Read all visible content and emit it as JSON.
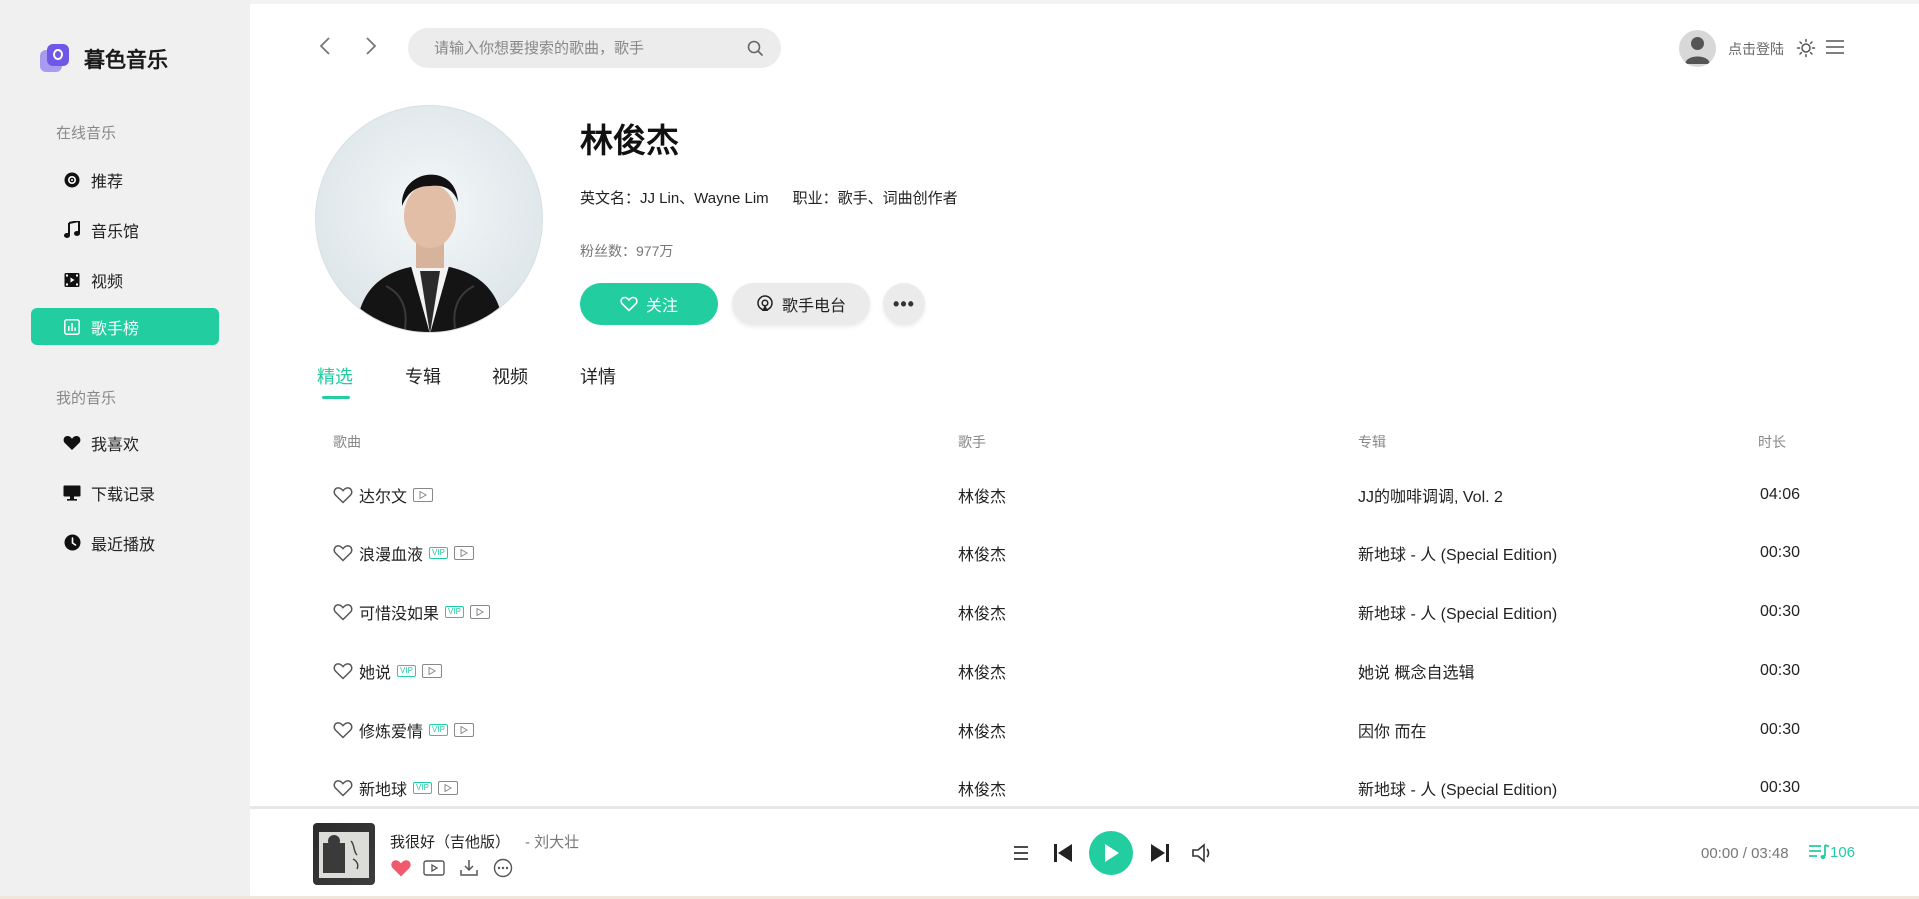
{
  "app": {
    "name": "暮色音乐"
  },
  "sidebar": {
    "group_online": "在线音乐",
    "online_items": [
      {
        "label": "推荐",
        "icon": "disc-icon"
      },
      {
        "label": "音乐馆",
        "icon": "music-note-icon"
      },
      {
        "label": "视频",
        "icon": "video-icon"
      },
      {
        "label": "歌手榜",
        "icon": "chart-icon",
        "active": true
      }
    ],
    "group_mine": "我的音乐",
    "mine_items": [
      {
        "label": "我喜欢",
        "icon": "heart-icon"
      },
      {
        "label": "下载记录",
        "icon": "monitor-icon"
      },
      {
        "label": "最近播放",
        "icon": "clock-icon"
      }
    ]
  },
  "header": {
    "search_placeholder": "请输入你想要搜索的歌曲，歌手",
    "login_text": "点击登陆"
  },
  "artist": {
    "name": "林俊杰",
    "english_name": "英文名：JJ Lin、Wayne Lim",
    "occupation": "职业：歌手、词曲创作者",
    "fans": "粉丝数：977万",
    "follow_label": "关注",
    "radio_label": "歌手电台",
    "more_label": "•••"
  },
  "tabs": [
    {
      "label": "精选",
      "active": true
    },
    {
      "label": "专辑"
    },
    {
      "label": "视频"
    },
    {
      "label": "详情"
    }
  ],
  "table": {
    "headers": {
      "song": "歌曲",
      "singer": "歌手",
      "album": "专辑",
      "duration": "时长"
    },
    "rows": [
      {
        "title": "达尔文",
        "vip": false,
        "singer": "林俊杰",
        "album": "JJ的咖啡调调, Vol. 2",
        "duration": "04:06"
      },
      {
        "title": "浪漫血液",
        "vip": true,
        "singer": "林俊杰",
        "album": "新地球 - 人 (Special Edition)",
        "duration": "00:30"
      },
      {
        "title": "可惜没如果",
        "vip": true,
        "singer": "林俊杰",
        "album": "新地球 - 人 (Special Edition)",
        "duration": "00:30"
      },
      {
        "title": "她说",
        "vip": true,
        "singer": "林俊杰",
        "album": "她说 概念自选辑",
        "duration": "00:30"
      },
      {
        "title": "修炼爱情",
        "vip": true,
        "singer": "林俊杰",
        "album": "因你 而在",
        "duration": "00:30"
      },
      {
        "title": "新地球",
        "vip": true,
        "singer": "林俊杰",
        "album": "新地球 - 人 (Special Edition)",
        "duration": "00:30"
      }
    ],
    "vip_tag": "VIP"
  },
  "player": {
    "song_title": "我很好（吉他版）",
    "song_artist": "- 刘大壮",
    "current_time": "00:00",
    "total_time": "03:48",
    "time_separator": " / ",
    "playlist_count": "106",
    "liked": true
  },
  "colors": {
    "accent": "#22ce9f",
    "sidebar_bg": "#f0f0f0",
    "liked": "#f05a6e"
  }
}
